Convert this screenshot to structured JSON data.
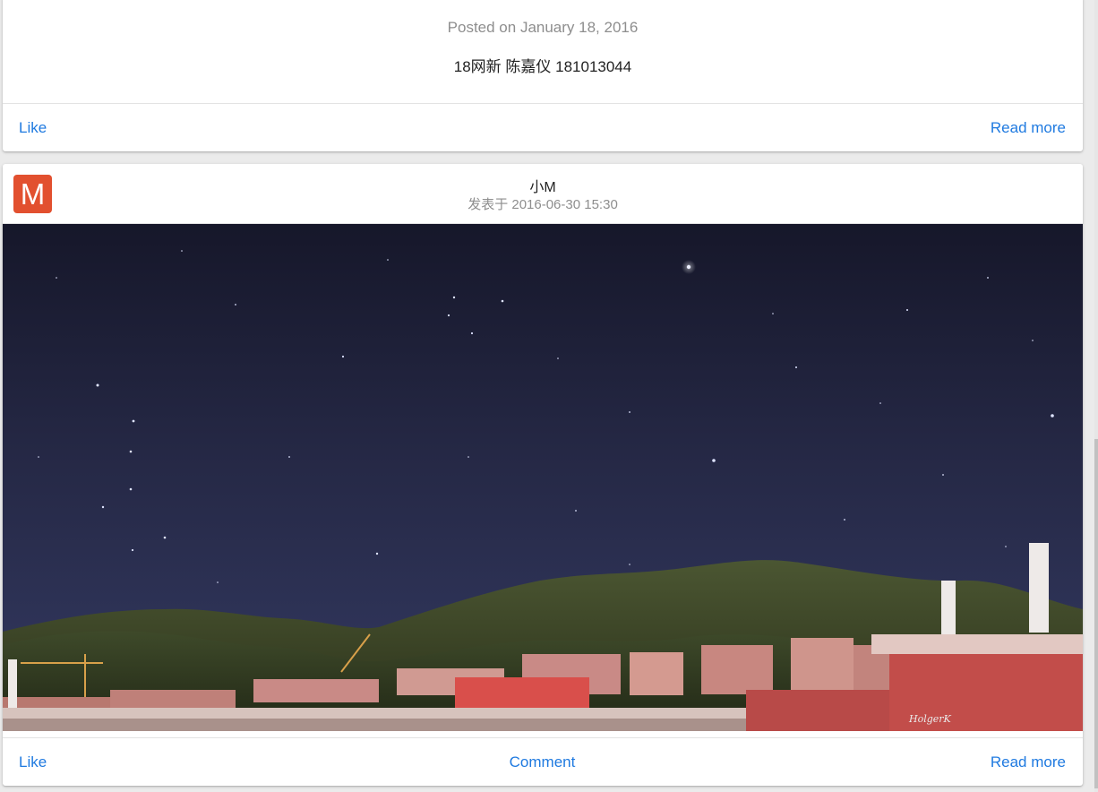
{
  "post1": {
    "posted_date": "Posted on January 18, 2016",
    "text": "18网新 陈嘉仪 181013044",
    "like_label": "Like",
    "read_more_label": "Read more"
  },
  "post2": {
    "avatar_letter": "M",
    "avatar_color": "#e2502f",
    "author": "小M",
    "meta": "发表于 2016-06-30 15:30",
    "photo_watermark": "HolgerK",
    "like_label": "Like",
    "comment_label": "Comment",
    "read_more_label": "Read more"
  },
  "colors": {
    "link": "#1f7ae0",
    "muted_text": "#8e8e8e"
  }
}
